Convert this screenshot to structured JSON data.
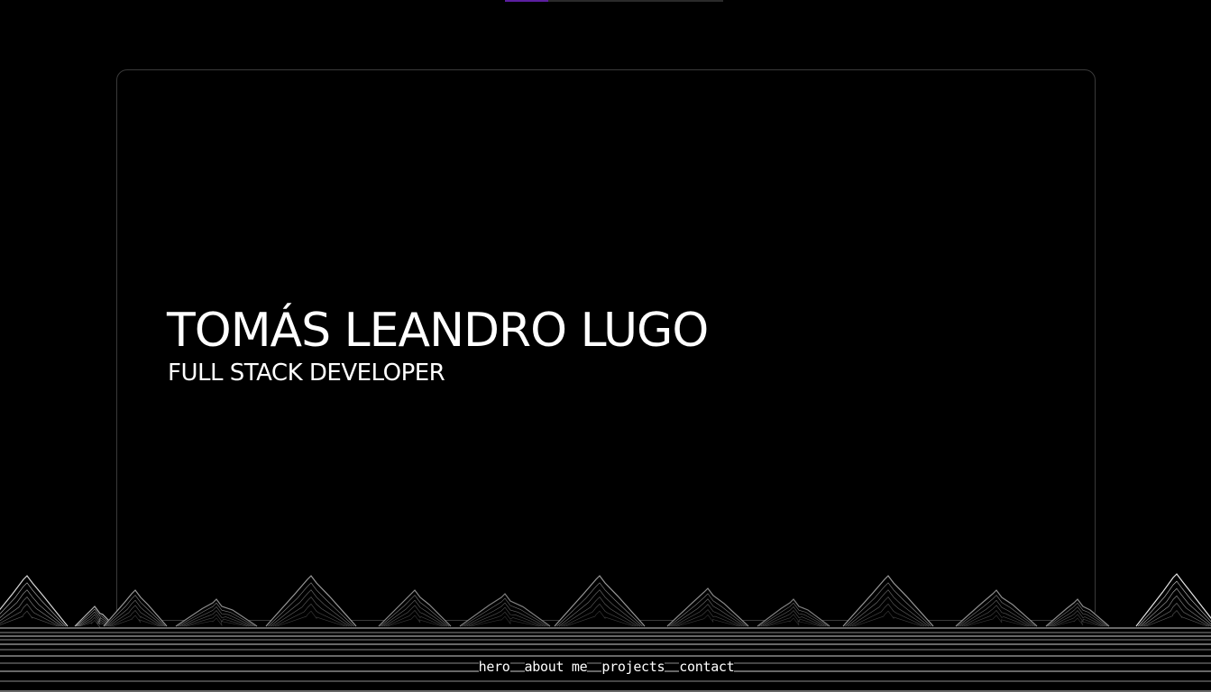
{
  "scroll_progress": 0.2,
  "colors": {
    "background": "#000000",
    "text": "#ffffff",
    "accent": "#5b1ea0",
    "frame_border": "#3a3a3a"
  },
  "hero": {
    "name": "TOMÁS LEANDRO LUGO",
    "role": "FULL STACK DEVELOPER"
  },
  "nav": {
    "items": [
      {
        "label": "hero"
      },
      {
        "label": "about me"
      },
      {
        "label": "projects"
      },
      {
        "label": "contact"
      }
    ]
  }
}
